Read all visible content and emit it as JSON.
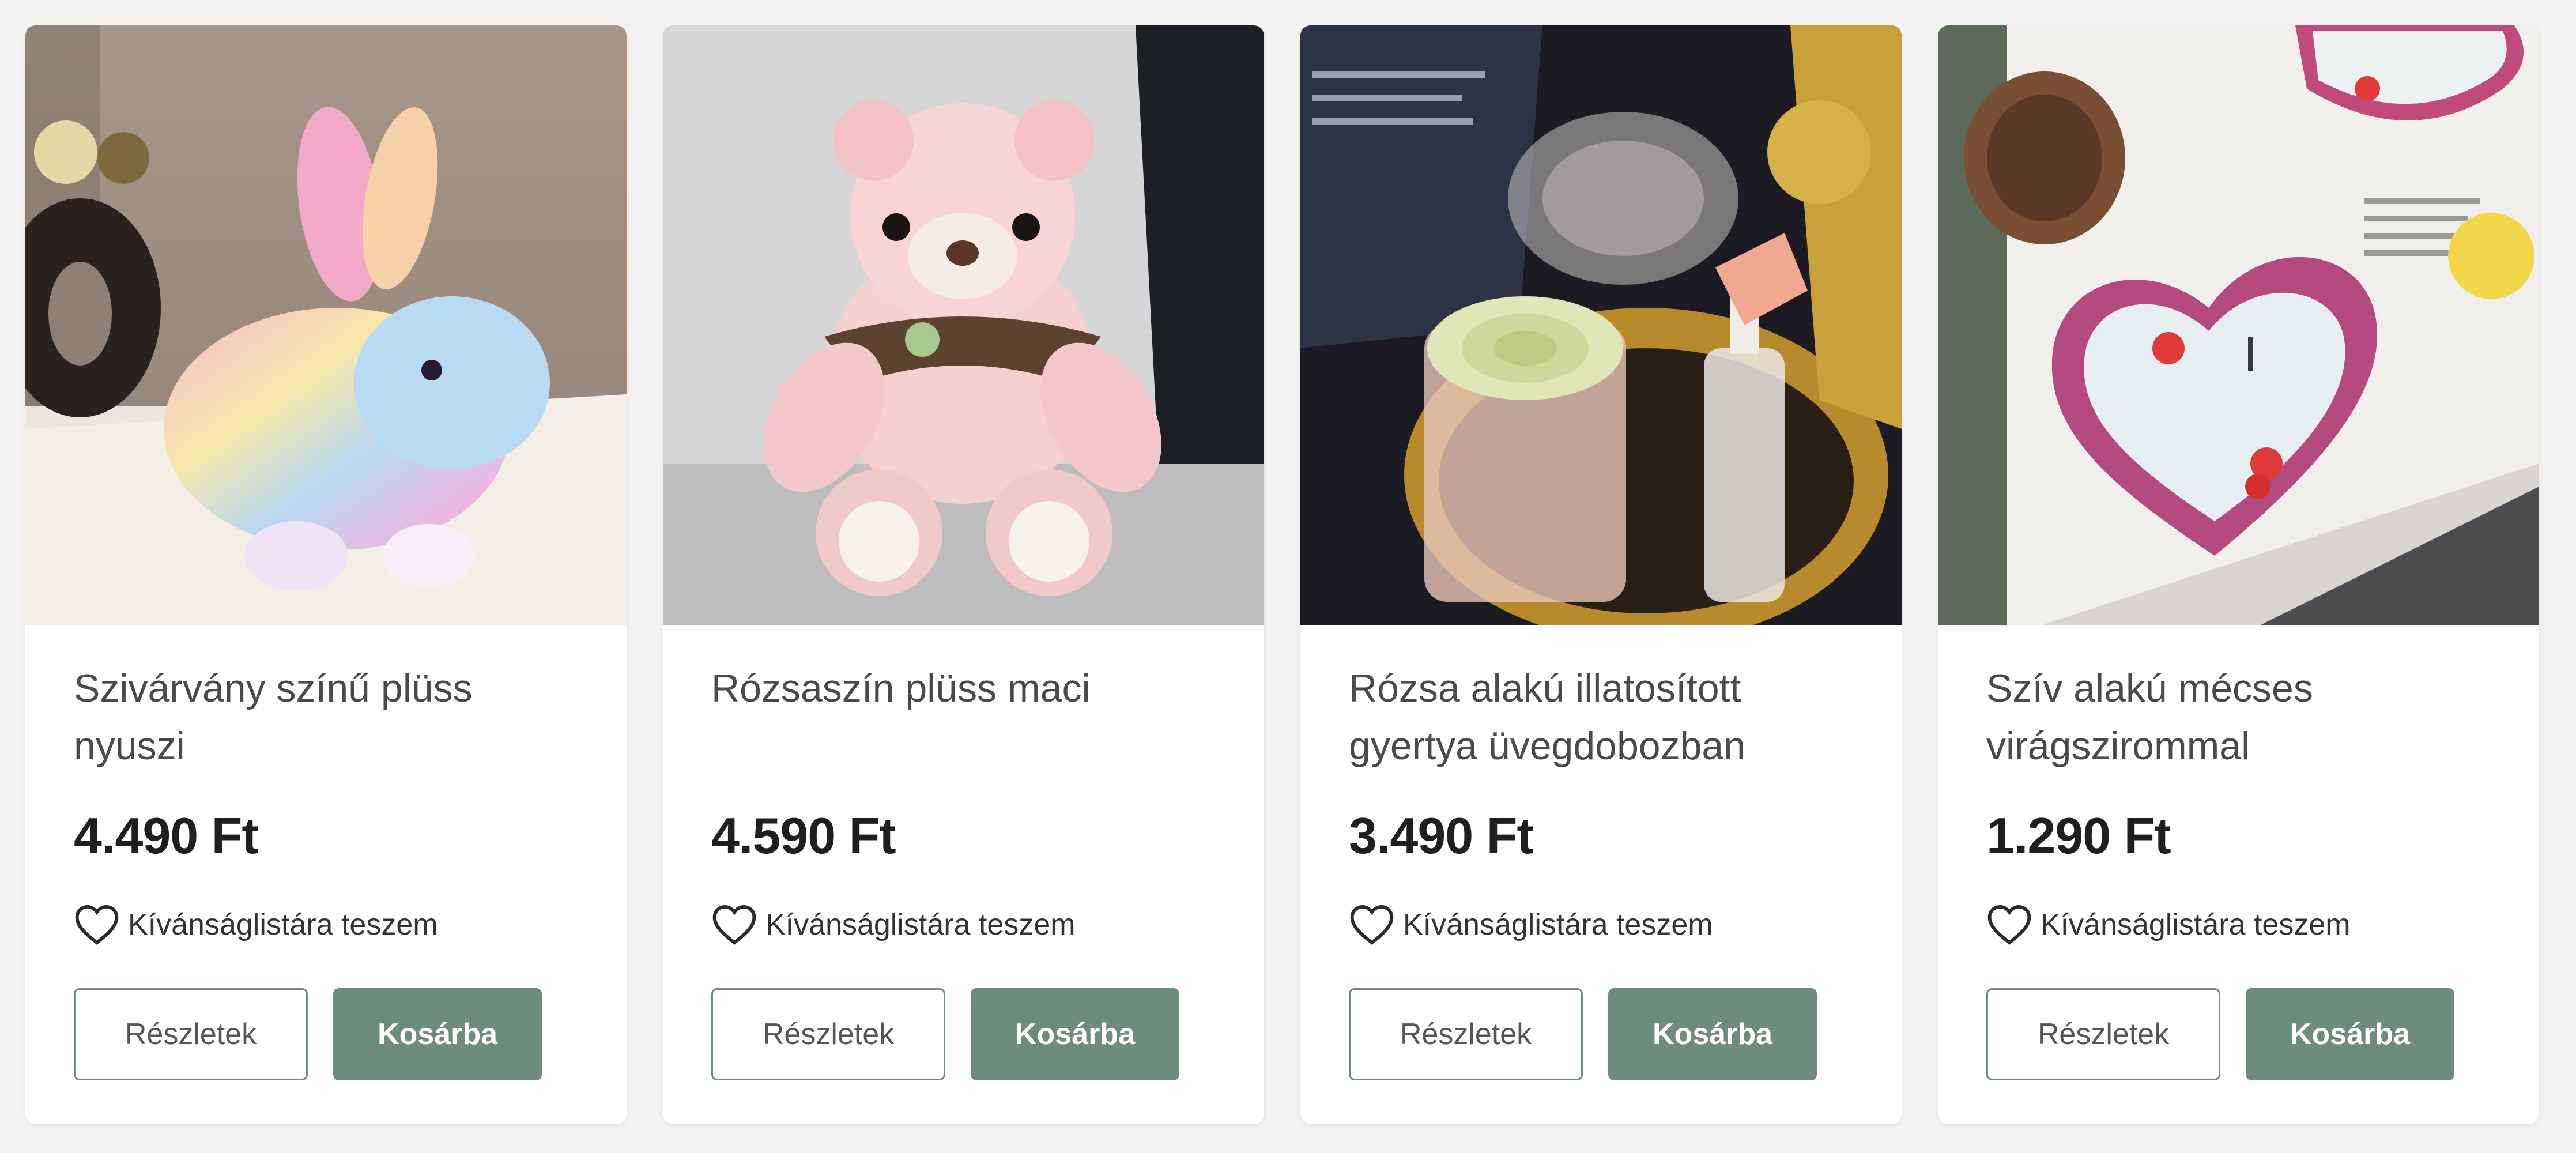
{
  "products": [
    {
      "title": "Szivárvány színű plüss nyuszi",
      "price": "4.490 Ft",
      "wishlist_label": "Kívánságlistára teszem",
      "details_label": "Részletek",
      "cart_label": "Kosárba",
      "image": "rainbow-plush-bunny"
    },
    {
      "title": "Rózsaszín plüss maci",
      "price": "4.590 Ft",
      "wishlist_label": "Kívánságlistára teszem",
      "details_label": "Részletek",
      "cart_label": "Kosárba",
      "image": "pink-teddy-bear"
    },
    {
      "title": "Rózsa alakú illatosított gyertya üvegdobozban",
      "price": "3.490 Ft",
      "wishlist_label": "Kívánságlistára teszem",
      "details_label": "Részletek",
      "cart_label": "Kosárba",
      "image": "rose-candle-glass-box"
    },
    {
      "title": "Szív alakú mécses virágszirommal",
      "price": "1.290 Ft",
      "wishlist_label": "Kívánságlistára teszem",
      "details_label": "Részletek",
      "cart_label": "Kosárba",
      "image": "heart-candle-petals"
    }
  ],
  "colors": {
    "accent": "#6d8c7e",
    "background": "#f2f2f2",
    "card": "#ffffff",
    "price": "#1f1f1f"
  },
  "icons": {
    "wishlist": "heart-outline-icon"
  }
}
